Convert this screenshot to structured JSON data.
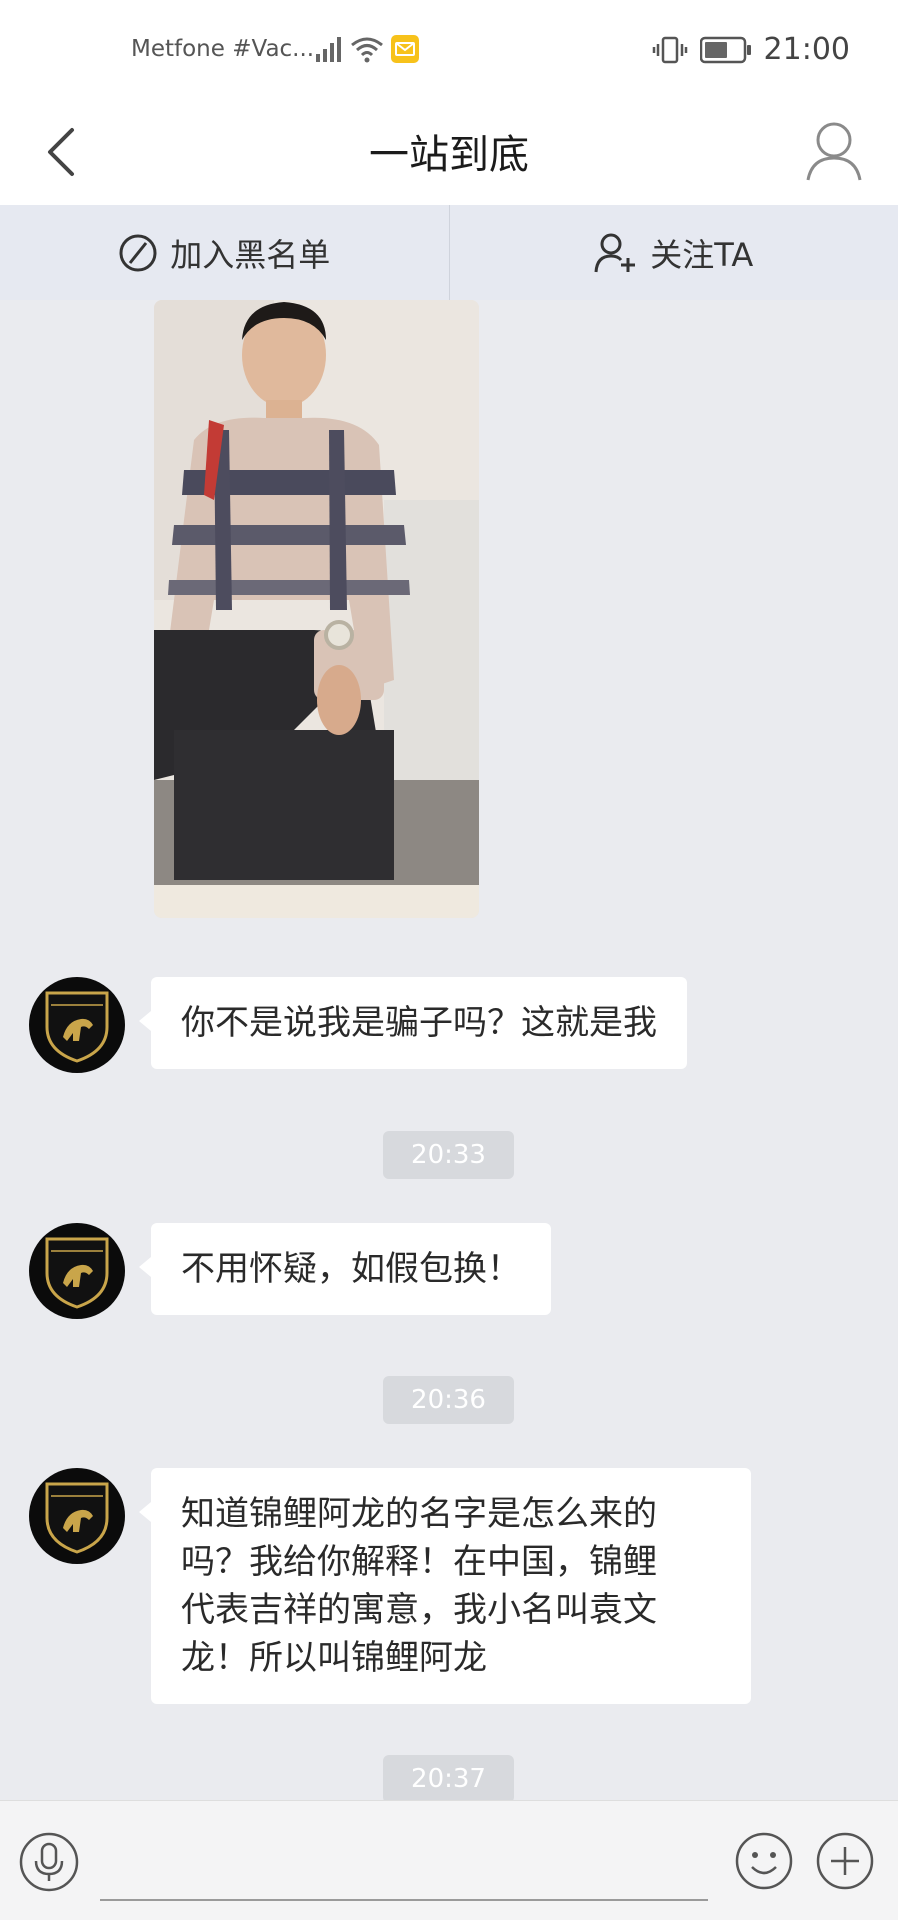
{
  "status_bar": {
    "carrier": "Metfone #Vac...",
    "time": "21:00"
  },
  "header": {
    "title": "一站到底"
  },
  "actions": {
    "blacklist_label": "加入黑名单",
    "follow_label": "关注TA"
  },
  "messages": [
    {
      "type": "text",
      "text": "你不是说我是骗子吗？这就是我"
    },
    {
      "type": "timestamp",
      "text": "20:33"
    },
    {
      "type": "text",
      "text": "不用怀疑，如假包换！"
    },
    {
      "type": "timestamp",
      "text": "20:36"
    },
    {
      "type": "text",
      "lines": [
        "知道锦鲤阿龙的名字是怎么来的",
        "吗？我给你解释！在中国，锦鲤",
        "代表吉祥的寓意，我小名叫袁文",
        "龙！所以叫锦鲤阿龙"
      ]
    },
    {
      "type": "timestamp",
      "text": "20:37"
    }
  ],
  "colors": {
    "background": "#eaebef",
    "bubble": "#ffffff",
    "timestamp_bg": "#d7d9dd",
    "action_bar": "#e6e9f1"
  },
  "icons": [
    "back-arrow-icon",
    "user-profile-icon",
    "block-icon",
    "add-user-icon",
    "microphone-icon",
    "emoji-icon",
    "plus-icon",
    "lamborghini-logo"
  ]
}
